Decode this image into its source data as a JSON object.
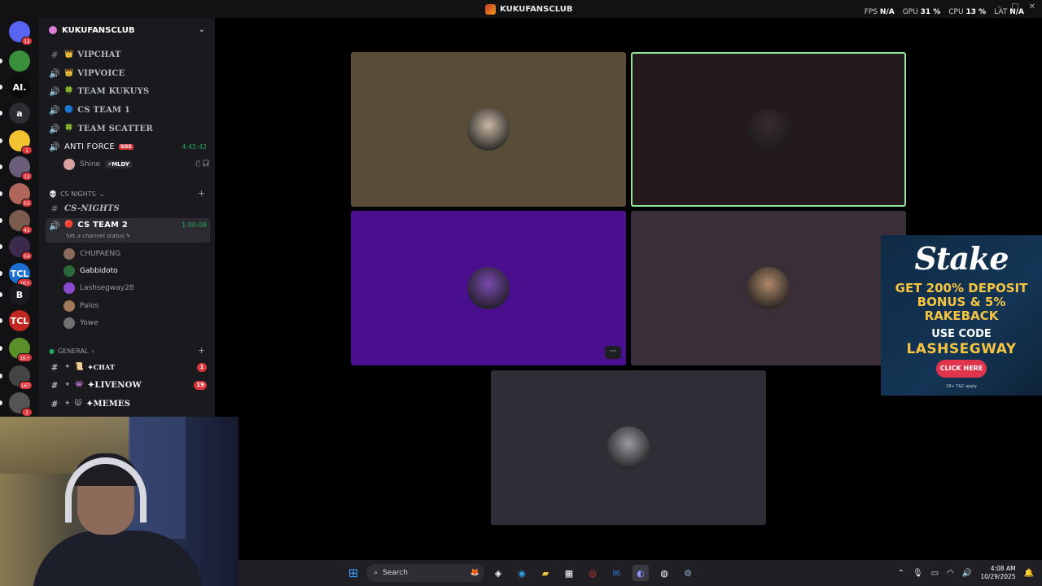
{
  "window": {
    "title": "KUKUFANSCLUB",
    "stats": [
      {
        "label": "FPS",
        "value": "N/A"
      },
      {
        "label": "GPU",
        "value": "31 %"
      },
      {
        "label": "CPU",
        "value": "13 %"
      },
      {
        "label": "LAT",
        "value": "N/A"
      }
    ]
  },
  "rail": {
    "servers": [
      {
        "name": "direct-messages",
        "glyph": "",
        "color": "#5865f2",
        "badge": "12"
      },
      {
        "name": "pepe-server",
        "glyph": "",
        "color": "#3a8f3a",
        "badge": ""
      },
      {
        "name": "ai-server",
        "glyph": "AI.",
        "color": "#0b0b0b",
        "badge": ""
      },
      {
        "name": "a-server",
        "glyph": "a",
        "color": "#2b2d31",
        "badge": ""
      },
      {
        "name": "pikachu-server",
        "glyph": "",
        "color": "#f2c230",
        "badge": "1"
      },
      {
        "name": "monday-server",
        "glyph": "",
        "color": "#6a5d7a",
        "badge": "12"
      },
      {
        "name": "girl-server",
        "glyph": "",
        "color": "#b0665a",
        "badge": "55"
      },
      {
        "name": "face-server",
        "glyph": "",
        "color": "#7a5c4e",
        "badge": "41"
      },
      {
        "name": "anime-server",
        "glyph": "",
        "color": "#3c2a4d",
        "badge": "54"
      },
      {
        "name": "tcl-server",
        "glyph": "TCL",
        "color": "#1a6fd1",
        "badge": "1K+"
      },
      {
        "name": "b-server",
        "glyph": "B",
        "color": "#1a1a1e",
        "badge": ""
      },
      {
        "name": "red-tcl-server",
        "glyph": "TCL",
        "color": "#c0261f",
        "badge": ""
      },
      {
        "name": "esports-server",
        "glyph": "",
        "color": "#5a8f2a",
        "badge": "1K+"
      },
      {
        "name": "avg-server",
        "glyph": "",
        "color": "#444",
        "badge": "167"
      },
      {
        "name": "skull-server",
        "glyph": "",
        "color": "#555",
        "badge": "2"
      }
    ]
  },
  "sidebar": {
    "server_name": "KUKUFANSCLUB",
    "channels": [
      {
        "type": "text",
        "emoji": "👑",
        "name": "VIPCHAT"
      },
      {
        "type": "voice",
        "emoji": "👑",
        "name": "VIPVOICE"
      },
      {
        "type": "voice",
        "emoji": "🍀",
        "name": "TEAM KUKUYS"
      },
      {
        "type": "voice",
        "emoji": "🔵",
        "name": "CS TEAM 1"
      },
      {
        "type": "voice",
        "emoji": "🍀",
        "name": "TEAM SCATTER"
      }
    ],
    "anti_force": {
      "name": "ANTI FORCE",
      "tag": "SOS",
      "timer": "4:45:42"
    },
    "anti_force_user": {
      "name": "Shine",
      "badge": "MLDY"
    },
    "cs_nights_category": "CS NIGHTS",
    "cs_nights_channel": "CS-NIGHTS",
    "cs_team2": {
      "name": "CS TEAM 2",
      "timer": "1:00:08",
      "status": "Set a channel status"
    },
    "cs_team2_users": [
      {
        "name": "CHUPAENG",
        "color": "#8a6a5a",
        "online": false
      },
      {
        "name": "Gabbidoto",
        "color": "#2a6a3a",
        "online": true
      },
      {
        "name": "Lashsegway28",
        "color": "#8a4ad0",
        "online": false
      },
      {
        "name": "Palos",
        "color": "#a07a5a",
        "online": false
      },
      {
        "name": "Yowe",
        "color": "#707070",
        "online": false
      }
    ],
    "general_category": "GENERAL",
    "general_channels": [
      {
        "name": "✦CHAT",
        "prefix": "✦",
        "emoji": "📜",
        "count": "1"
      },
      {
        "name": "✦LIVENOW",
        "prefix": "✦",
        "emoji": "👾",
        "count": "19"
      },
      {
        "name": "✦MEMES",
        "prefix": "✦",
        "emoji": "😸",
        "count": ""
      }
    ]
  },
  "video_tiles": [
    {
      "name": "tile-1",
      "bg": "#5a4d38",
      "avatar_color": "#c9b7a4",
      "speaking": false
    },
    {
      "name": "tile-2",
      "bg": "#241a1c",
      "avatar_color": "#3a2a2e",
      "speaking": true
    },
    {
      "name": "tile-3",
      "bg": "#4a0f8f",
      "avatar_color": "#7a4ab0",
      "speaking": false
    },
    {
      "name": "tile-4",
      "bg": "#3a2e38",
      "avatar_color": "#b08a6a",
      "speaking": false
    },
    {
      "name": "tile-5",
      "bg": "#2e2e36",
      "avatar_color": "#9a9aa2",
      "speaking": false
    }
  ],
  "ad": {
    "brand": "Stake",
    "line1": "GET 200% DEPOSIT",
    "line2": "BONUS & 5%",
    "line3": "RAKEBACK",
    "use_code": "USE CODE",
    "code": "LASHSEGWAY",
    "cta": "CLICK HERE",
    "fine": "18+ T&C apply"
  },
  "taskbar": {
    "search_placeholder": "Search",
    "time": "4:08 AM",
    "date": "10/29/2025"
  }
}
